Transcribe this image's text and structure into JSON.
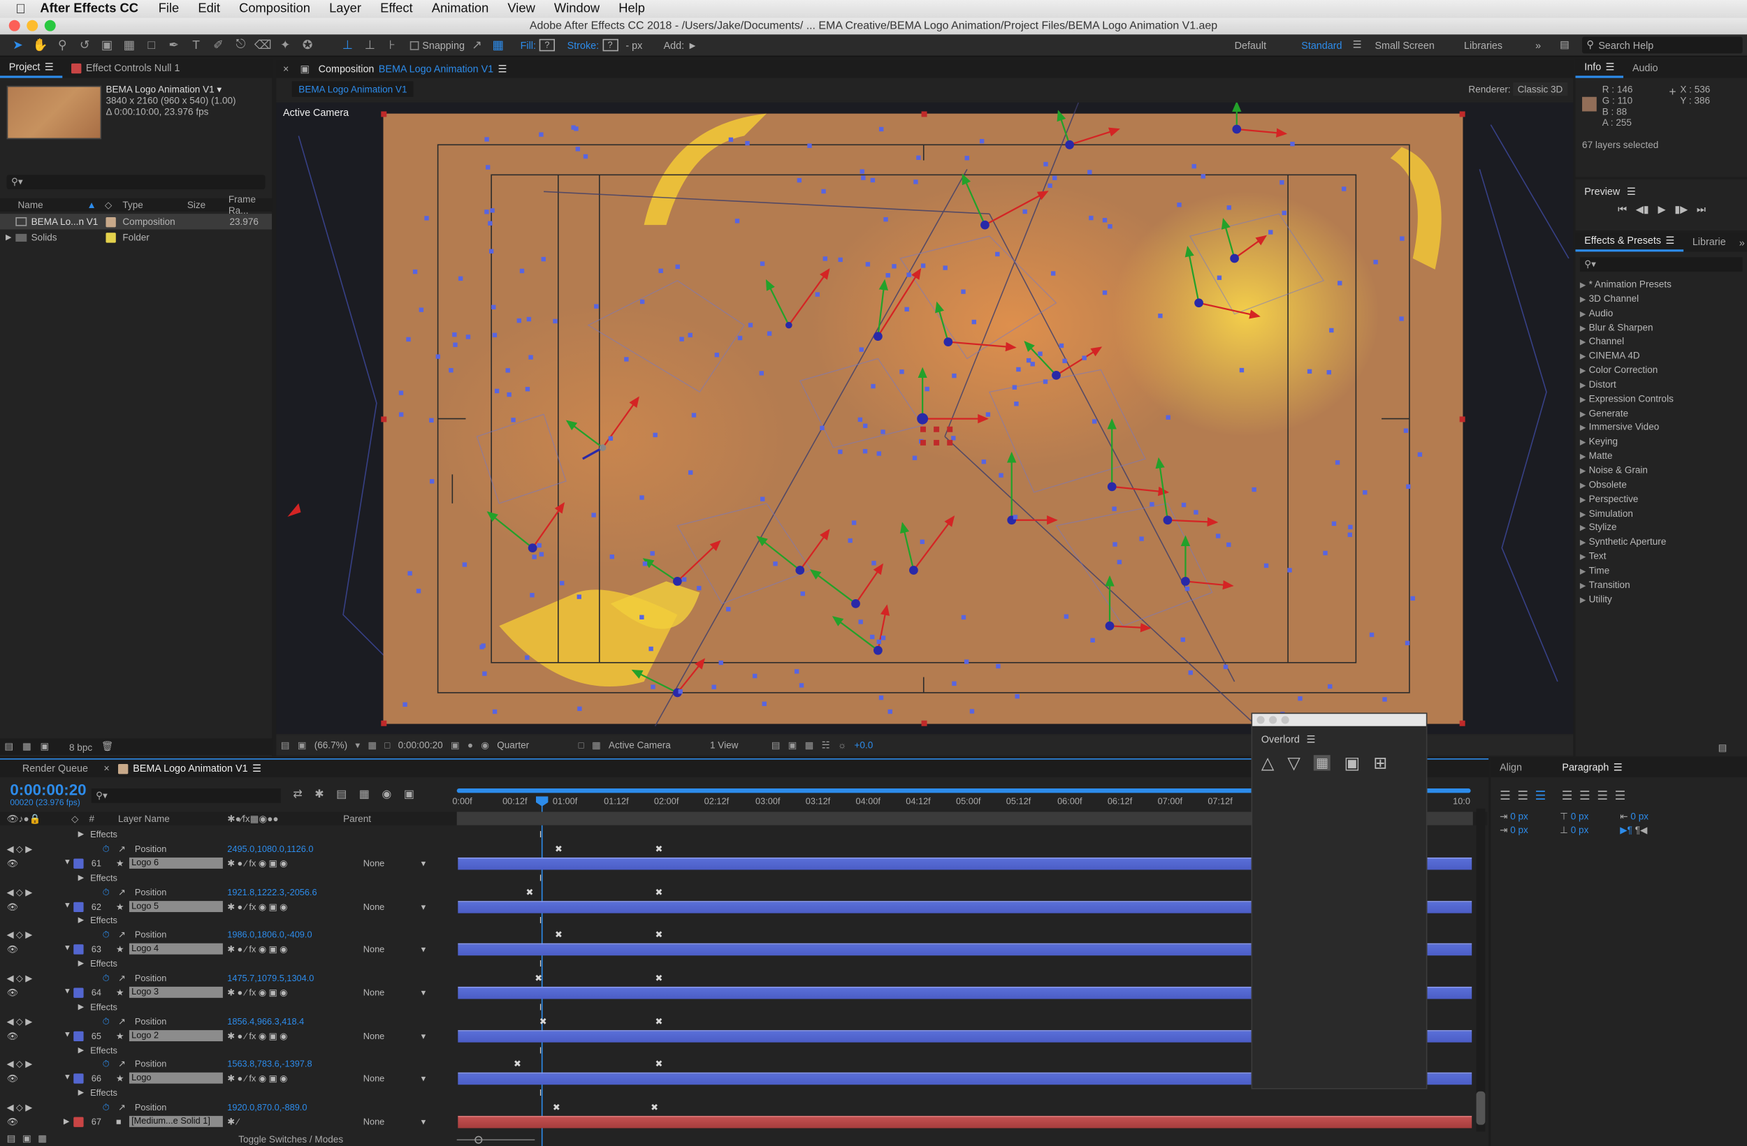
{
  "menubar": {
    "app": "After Effects CC",
    "items": [
      "File",
      "Edit",
      "Composition",
      "Layer",
      "Effect",
      "Animation",
      "View",
      "Window",
      "Help"
    ]
  },
  "window_title": "Adobe After Effects CC 2018 - /Users/Jake/Documents/ ... EMA Creative/BEMA Logo Animation/Project Files/BEMA Logo Animation V1.aep",
  "toolbar": {
    "snapping": "Snapping",
    "fill": "Fill:",
    "stroke": "Stroke:",
    "px": "- px",
    "add": "Add:",
    "workspaces": [
      "Default",
      "Standard",
      "Small Screen",
      "Libraries"
    ],
    "active_workspace": "Standard",
    "search_placeholder": "Search Help"
  },
  "project": {
    "tab": "Project",
    "tab2": "Effect Controls Null 1",
    "comp_name": "BEMA Logo Animation V1 ▾",
    "comp_res": "3840 x 2160  (960 x 540) (1.00)",
    "comp_dur": "Δ 0:00:10:00, 23.976 fps",
    "columns": [
      "Name",
      "Type",
      "Size",
      "Frame Ra..."
    ],
    "items": [
      {
        "name": "BEMA Lo...n V1",
        "type": "Composition",
        "fps": "23.976",
        "color": "#c8a98a"
      },
      {
        "name": "Solids",
        "type": "Folder",
        "fps": "",
        "color": "#e3d14c"
      }
    ],
    "bpc": "8 bpc"
  },
  "composition": {
    "tab_prefix": "Composition",
    "tab_name": "BEMA Logo Animation V1",
    "subtab": "BEMA Logo Animation V1",
    "renderer_label": "Renderer:",
    "renderer": "Classic 3D",
    "camera_label": "Active Camera"
  },
  "viewer_bar": {
    "zoom": "(66.7%)",
    "time": "0:00:00:20",
    "resolution": "Quarter",
    "view": "Active Camera",
    "views": "1 View",
    "exposure": "+0.0"
  },
  "info": {
    "tab": "Info",
    "tab2": "Audio",
    "r": "R : 146",
    "g": "G : 110",
    "b": "B : 88",
    "a": "A : 255",
    "x": "X : 536",
    "y": "Y : 386",
    "swatch": "#926e58",
    "selected": "67 layers selected"
  },
  "preview": {
    "title": "Preview"
  },
  "effects": {
    "tab": "Effects & Presets",
    "tab2": "Librarie",
    "items": [
      "* Animation Presets",
      "3D Channel",
      "Audio",
      "Blur & Sharpen",
      "Channel",
      "CINEMA 4D",
      "Color Correction",
      "Distort",
      "Expression Controls",
      "Generate",
      "Immersive Video",
      "Keying",
      "Matte",
      "Noise & Grain",
      "Obsolete",
      "Perspective",
      "Simulation",
      "Stylize",
      "Synthetic Aperture",
      "Text",
      "Time",
      "Transition",
      "Utility"
    ]
  },
  "timeline": {
    "tab1": "Render Queue",
    "tab2": "BEMA Logo Animation V1",
    "timecode": "0:00:00:20",
    "frame": "00020 (23.976 fps)",
    "col_layer": "Layer Name",
    "col_parent": "Parent",
    "col_num": "#",
    "ruler": [
      "0:00f",
      "00:12f",
      "01:00f",
      "01:12f",
      "02:00f",
      "02:12f",
      "03:00f",
      "03:12f",
      "04:00f",
      "04:12f",
      "05:00f",
      "05:12f",
      "06:00f",
      "06:12f",
      "07:00f",
      "07:12f",
      "10:0"
    ],
    "effects_label": "Effects",
    "position_label": "Position",
    "parent_none": "None",
    "layers": [
      {
        "num": "61",
        "name": "Logo 6",
        "pos": "2495.0,1080.0,1126.0"
      },
      {
        "num": "62",
        "name": "Logo 5",
        "pos": "1921.8,1222.3,-2056.6"
      },
      {
        "num": "63",
        "name": "Logo 4",
        "pos": "1986.0,1806.0,-409.0"
      },
      {
        "num": "64",
        "name": "Logo 3",
        "pos": "1475.7,1079.5,1304.0"
      },
      {
        "num": "65",
        "name": "Logo 2",
        "pos": "1856.4,966.3,418.4"
      },
      {
        "num": "66",
        "name": "Logo",
        "pos": "1563.8,783.6,-1397.8"
      }
    ],
    "last_layer": {
      "num": "67",
      "name": "[Medium...e Solid 1]"
    },
    "extra_position": "1920.0,870.0,-889.0",
    "toggle": "Toggle Switches / Modes"
  },
  "overlord": {
    "title": "Overlord"
  },
  "align": {
    "tab": "Align",
    "tab2": "Paragraph",
    "values": [
      "0 px",
      "0 px",
      "0 px",
      "0 px",
      "0 px"
    ]
  },
  "colors": {
    "accent": "#2d8ceb",
    "layer_bar": "#5366d0",
    "solid_bar": "#b94a4a",
    "comp_bg": "#b47c50"
  }
}
